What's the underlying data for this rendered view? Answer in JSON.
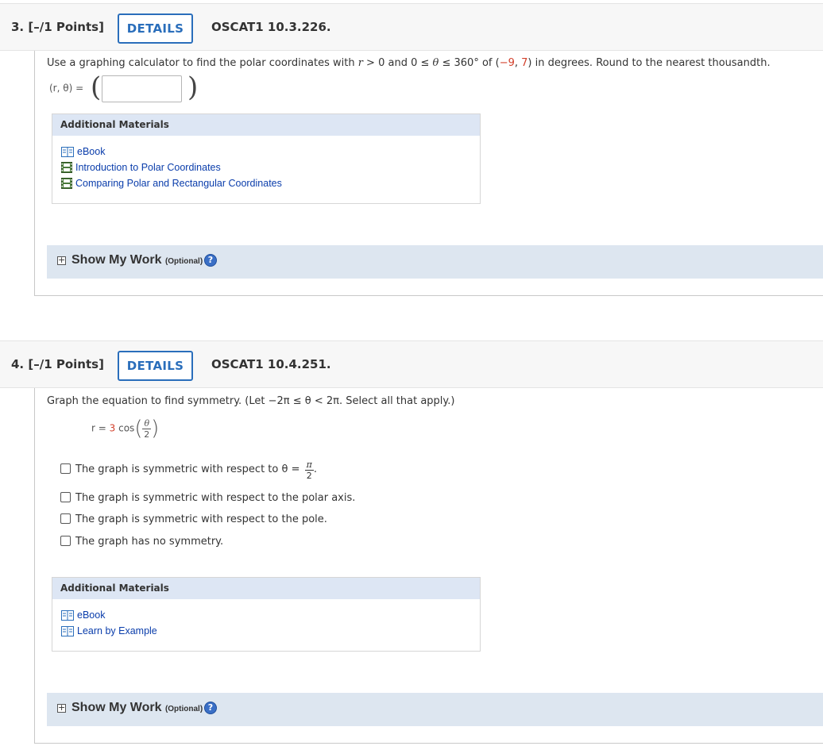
{
  "questions": [
    {
      "number": "3.",
      "points": "[–/1 Points]",
      "details_label": "DETAILS",
      "code": "OSCAT1 10.3.226.",
      "prompt": {
        "pre": "Use a graphing calculator to find the polar coordinates with ",
        "r_var": "r",
        "cond1": " > 0 and 0 ≤ ",
        "theta_var": "θ",
        "cond2": " ≤ 360° of (",
        "x": "−9",
        "sep": ", ",
        "y": "7",
        "post": ") in degrees. Round to the nearest thousandth."
      },
      "answer_label": "(r, θ) =",
      "answer_value": "",
      "additional_materials_title": "Additional Materials",
      "materials": [
        "eBook",
        "Introduction to Polar Coordinates",
        "Comparing Polar and Rectangular Coordinates"
      ],
      "show_my_work": "Show My Work",
      "optional": "(Optional)",
      "help": "?"
    },
    {
      "number": "4.",
      "points": "[–/1 Points]",
      "details_label": "DETAILS",
      "code": "OSCAT1 10.4.251.",
      "prompt": {
        "pre": "Graph the equation to find symmetry. (Let ",
        "range": "−2π ≤ θ < 2π",
        "post": ". Select all that apply.)"
      },
      "equation": {
        "lhs": "r =",
        "coef": "3",
        "func": "cos",
        "num": "θ",
        "den": "2"
      },
      "options": [
        {
          "text": "The graph is symmetric with respect to θ =",
          "frac_num": "π",
          "frac_den": "2",
          "trail": ".",
          "checked": false
        },
        {
          "text": "The graph is symmetric with respect to the polar axis.",
          "checked": false
        },
        {
          "text": "The graph is symmetric with respect to the pole.",
          "checked": false
        },
        {
          "text": "The graph has no symmetry.",
          "checked": false
        }
      ],
      "additional_materials_title": "Additional Materials",
      "materials": [
        "eBook",
        "Learn by Example"
      ],
      "show_my_work": "Show My Work",
      "optional": "(Optional)",
      "help": "?"
    }
  ],
  "colors": {
    "link": "#0a3dab",
    "details_border": "#2a6ebb",
    "highlight_red": "#d23f2a",
    "materials_header": "#dde6f4",
    "show_work_bar": "#dde6f0"
  }
}
